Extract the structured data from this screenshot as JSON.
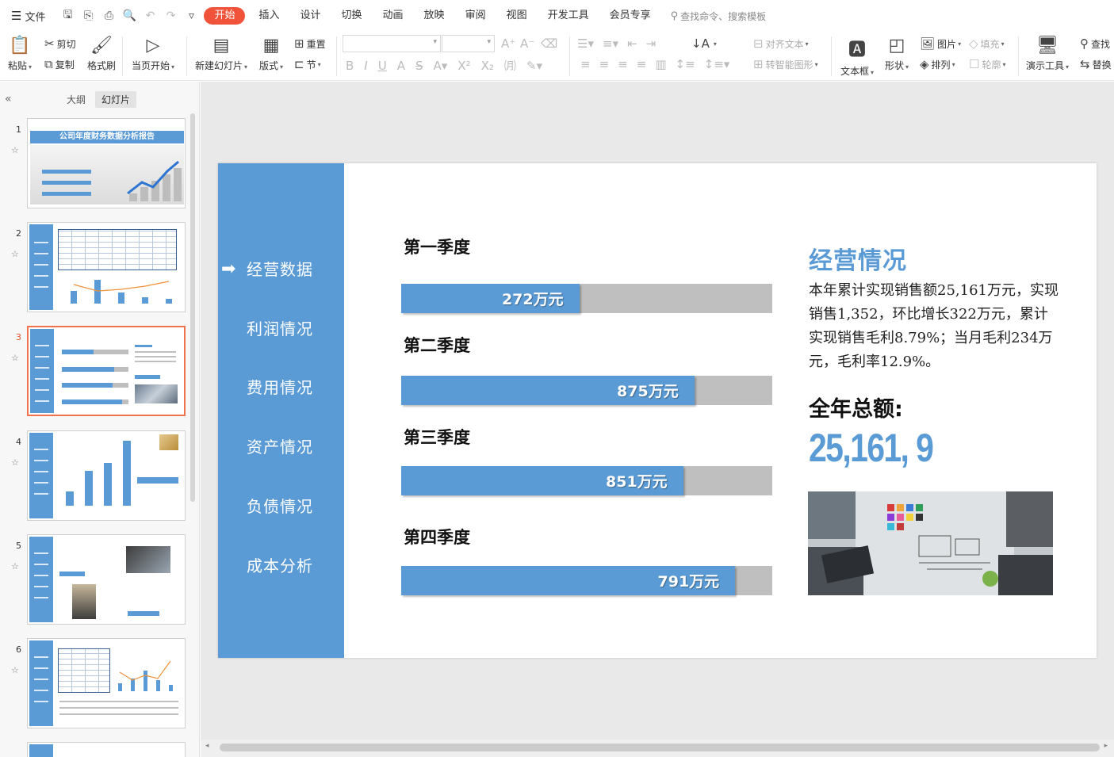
{
  "menubar": {
    "file_label": "文件",
    "tabs": [
      "开始",
      "插入",
      "设计",
      "切换",
      "动画",
      "放映",
      "审阅",
      "视图",
      "开发工具",
      "会员专享"
    ],
    "search_placeholder": "查找命令、搜索模板"
  },
  "ribbon": {
    "paste": "粘贴",
    "cut": "剪切",
    "copy": "复制",
    "format_painter": "格式刷",
    "from_current": "当页开始",
    "new_slide": "新建幻灯片",
    "layout": "版式",
    "reset": "重置",
    "section": "节",
    "align_text": "对齐文本",
    "smartart": "转智能图形",
    "textbox": "文本框",
    "shape": "形状",
    "picture": "图片",
    "arrange": "排列",
    "fill": "填充",
    "outline": "轮廓",
    "present_tools": "演示工具",
    "find": "查找",
    "replace": "替换"
  },
  "panel": {
    "tab_outline": "大纲",
    "tab_slides": "幻灯片",
    "slides": [
      {
        "num": "1",
        "title": "公司年度财务数据分析报告"
      },
      {
        "num": "2"
      },
      {
        "num": "3"
      },
      {
        "num": "4"
      },
      {
        "num": "5"
      },
      {
        "num": "6"
      }
    ],
    "active_slide": "3"
  },
  "slide": {
    "nav": [
      "经营数据",
      "利润情况",
      "费用情况",
      "资产情况",
      "负债情况",
      "成本分析"
    ],
    "active_nav": "经营数据",
    "quarters": [
      {
        "label": "第一季度",
        "value": "272万元",
        "fill": 0.48
      },
      {
        "label": "第二季度",
        "value": "875万元",
        "fill": 0.79
      },
      {
        "label": "第三季度",
        "value": "851万元",
        "fill": 0.76
      },
      {
        "label": "第四季度",
        "value": "791万元",
        "fill": 0.9
      }
    ],
    "right_heading": "经营情况",
    "right_paragraph": "本年累计实现销售额25,161万元，实现销售1,352，环比增长322万元，累计实现销售毛利8.79%；当月毛利234万元，毛利率12.9%。",
    "total_label": "全年总额:",
    "total_value": "25,161, 9"
  },
  "colors": {
    "accent_blue": "#5b9bd5",
    "bar_gray": "#bfbfbf",
    "active_tab": "#f0523a"
  }
}
